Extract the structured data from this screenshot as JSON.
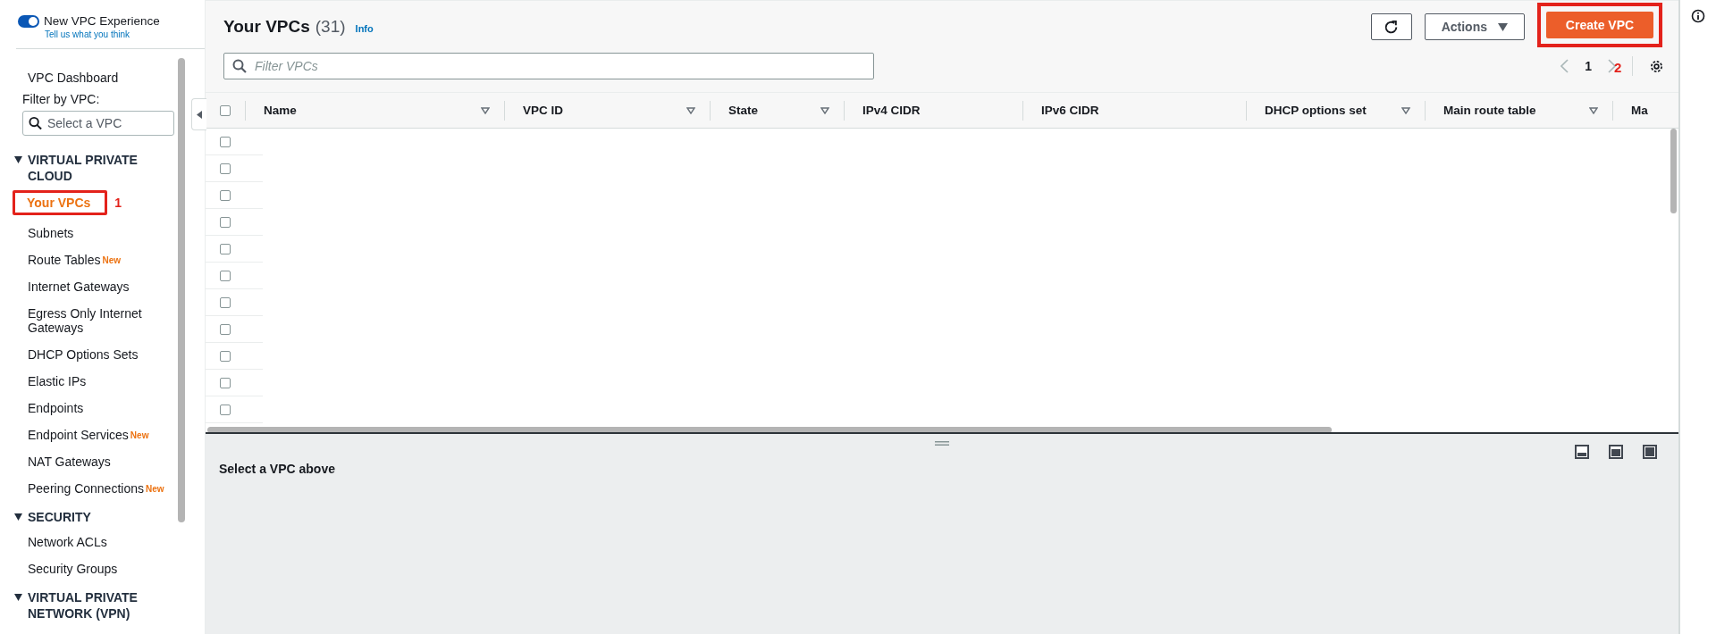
{
  "sidebar": {
    "toggle": {
      "label": "New VPC Experience",
      "on": true
    },
    "feedback_link": "Tell us what you think",
    "dashboard": "VPC Dashboard",
    "filter_label": "Filter by VPC:",
    "filter_placeholder": "Select a VPC",
    "sections": [
      {
        "title": "VIRTUAL PRIVATE CLOUD",
        "expanded": true,
        "items": [
          {
            "label": "Your VPCs",
            "selected": true,
            "annotation": "1"
          },
          {
            "label": "Subnets",
            "selected": false
          },
          {
            "label": "Route Tables",
            "selected": false,
            "badge": "New"
          },
          {
            "label": "Internet Gateways",
            "selected": false
          },
          {
            "label": "Egress Only Internet Gateways",
            "selected": false
          },
          {
            "label": "DHCP Options Sets",
            "selected": false
          },
          {
            "label": "Elastic IPs",
            "selected": false
          },
          {
            "label": "Endpoints",
            "selected": false
          },
          {
            "label": "Endpoint Services",
            "selected": false,
            "badge": "New"
          },
          {
            "label": "NAT Gateways",
            "selected": false
          },
          {
            "label": "Peering Connections",
            "selected": false,
            "badge": "New"
          }
        ]
      },
      {
        "title": "SECURITY",
        "expanded": true,
        "items": [
          {
            "label": "Network ACLs",
            "selected": false
          },
          {
            "label": "Security Groups",
            "selected": false
          }
        ]
      },
      {
        "title": "VIRTUAL PRIVATE NETWORK (VPN)",
        "expanded": true
      }
    ]
  },
  "header": {
    "title": "Your VPCs",
    "count": "(31)",
    "info": "Info",
    "actions_button": "Actions",
    "create_button": {
      "label": "Create VPC",
      "annotation": "2"
    }
  },
  "filter": {
    "placeholder": "Filter VPCs"
  },
  "pagination": {
    "page": "1"
  },
  "table": {
    "header_checked": false,
    "columns": [
      {
        "label": "Name",
        "sortable": true
      },
      {
        "label": "VPC ID",
        "sortable": true
      },
      {
        "label": "State",
        "sortable": true
      },
      {
        "label": "IPv4 CIDR",
        "sortable": false
      },
      {
        "label": "IPv6 CIDR",
        "sortable": false
      },
      {
        "label": "DHCP options set",
        "sortable": true
      },
      {
        "label": "Main route table",
        "sortable": true
      },
      {
        "label": "Ma",
        "sortable": false
      }
    ],
    "rows": [
      {
        "checked": false
      },
      {
        "checked": false
      },
      {
        "checked": false
      },
      {
        "checked": false
      },
      {
        "checked": false
      },
      {
        "checked": false
      },
      {
        "checked": false
      },
      {
        "checked": false
      },
      {
        "checked": false
      },
      {
        "checked": false
      },
      {
        "checked": false
      }
    ]
  },
  "details": {
    "message": "Select a VPC above"
  }
}
